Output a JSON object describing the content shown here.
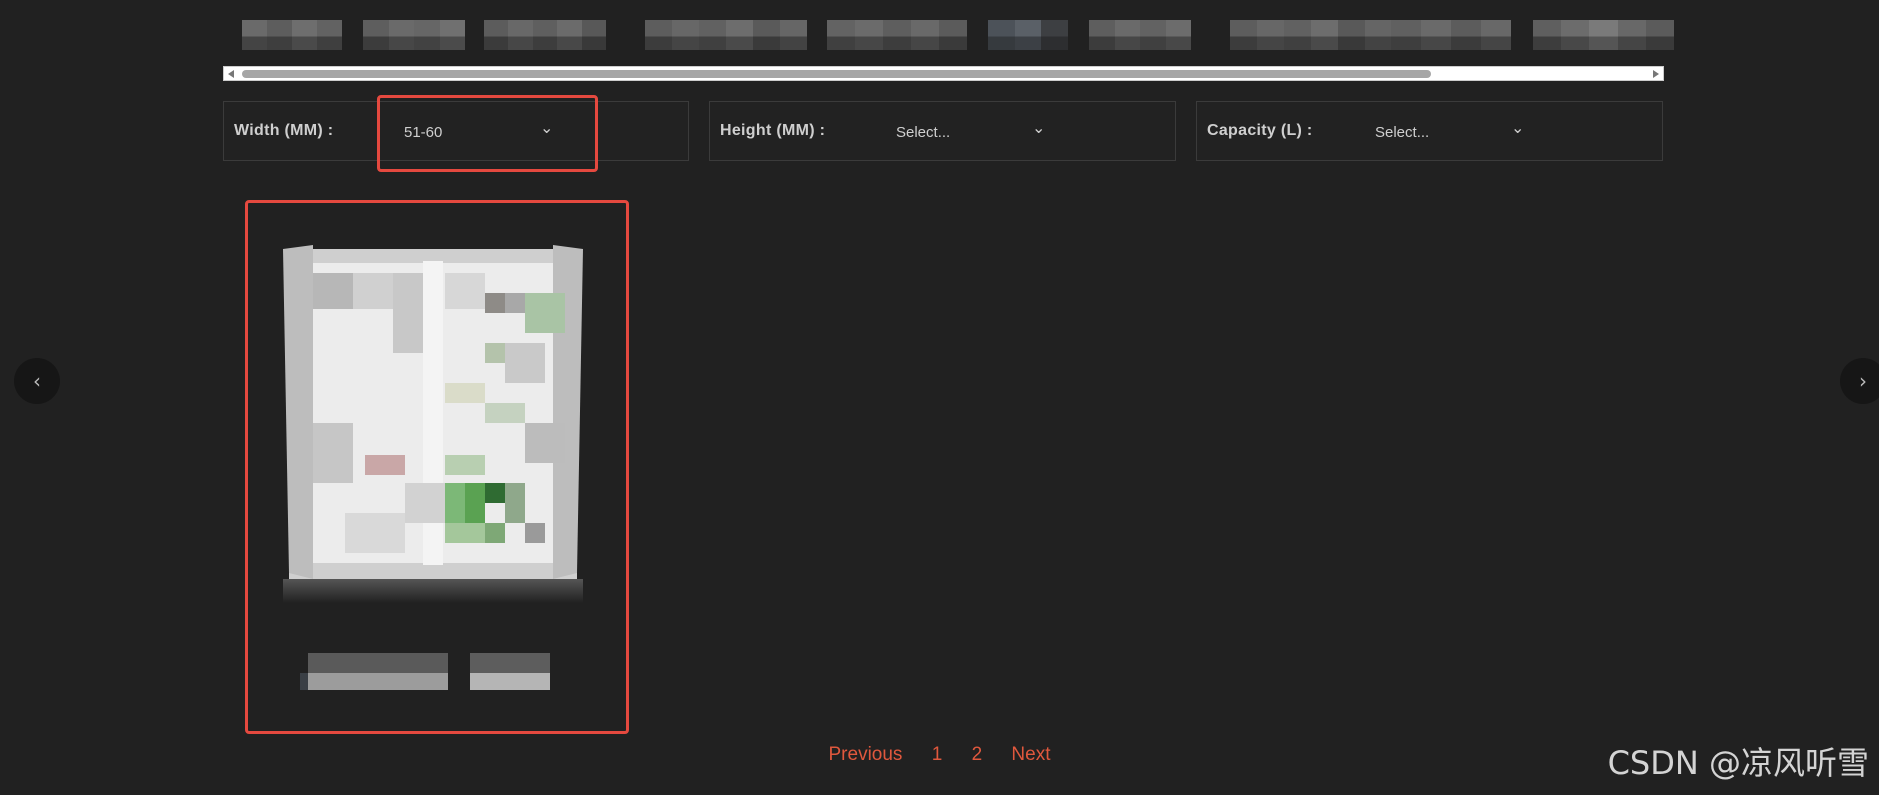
{
  "filters": {
    "width": {
      "label": "Width (MM) :",
      "value": "51-60"
    },
    "height": {
      "label": "Height (MM) :",
      "value": "Select..."
    },
    "capacity": {
      "label": "Capacity (L) :",
      "value": "Select..."
    }
  },
  "pagination": {
    "previous": "Previous",
    "pages": [
      "1",
      "2"
    ],
    "next": "Next"
  },
  "icons": {
    "prev_slide": "chevron-left-icon",
    "next_slide": "chevron-right-icon",
    "dropdown": "chevron-down-icon"
  },
  "colors": {
    "accent": "#e5493f",
    "pagination": "#e0583d",
    "background": "#212121"
  },
  "watermark": "CSDN @凉风听雪"
}
